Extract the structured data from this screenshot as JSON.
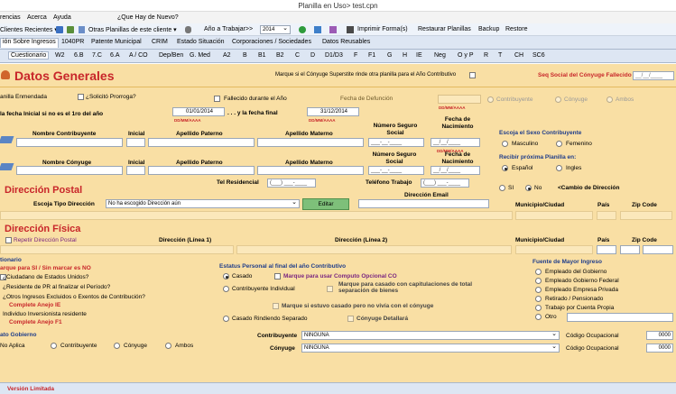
{
  "window": {
    "title": "Planilla en Uso> test.cpn"
  },
  "menu": {
    "items": [
      "rencias",
      "Acerca",
      "Ayuda",
      "¿Que Hay de Nuevo?"
    ]
  },
  "toolbar": {
    "clients": "Clientes Recientes ▾",
    "other": "Otras Planillas de este cliente ▾",
    "year_label": "Año a Trabajar>>",
    "year": "2014",
    "print": "Imprimir Forma(s)",
    "restore": "Restaurar Planillas",
    "backup": "Backup",
    "restaurar": "Restore"
  },
  "tabs1": [
    "ión Sobre Ingresos",
    "1040PR",
    "Patente Municipal",
    "CRIM",
    "Estado Situación",
    "Corporaciones / Sociedades",
    "Datos Reusables"
  ],
  "tabs2": [
    "Cuestionario",
    "W2",
    "6.B",
    "7.C",
    "6.A",
    "A / CO",
    "Dep/Ben",
    "G. Med",
    "A2",
    "B",
    "B1",
    "B2",
    "C",
    "D",
    "D1/D3",
    "F",
    "F1",
    "G",
    "H",
    "IE",
    "Neg",
    "O y P",
    "R",
    "T",
    "CH",
    "SC6"
  ],
  "form": {
    "title": "Datos Generales",
    "superstite": "Marque si el Cónyuge Superstite rinde otra planilla para el Año Contributivo",
    "ss_fallecido": "Seq Social del Cónyuge Fallecido",
    "ss_fallecido_val": "__/__/____",
    "enmendada": "anilla Enmendada",
    "prorroga": "¿Solicitó Prorroga?",
    "fallecido": "Fallecido durante el Año",
    "fecha_def": "Fecha de Defunción",
    "contribuyente_opt": "Contribuyente",
    "conyuge_opt": "Cónyuge",
    "ambos_opt": "Ambos",
    "fecha_inicial": "la fecha Inicial si no es el 1ro del año",
    "fecha_ini_val": "01/01/2014",
    "y_fecha_final": ". . . y la fecha final",
    "fecha_fin_val": "31/12/2014",
    "fmt": "DD/MM/AAAA",
    "nombre_contrib": "Nombre Contribuyente",
    "inicial": "Inicial",
    "ap_paterno": "Apellido Paterno",
    "ap_materno": "Apellido Materno",
    "num_ss": "Número Seguro Social",
    "fecha_nac": "Fecha de Nacimiento",
    "ss_mask": "___-__-____",
    "date_mask": "__/__/____",
    "sexo": "Escoja el Sexo Contribuyente",
    "masculino": "Masculino",
    "femenino": "Femenino",
    "nombre_cony": "Nombre Cónyuge",
    "recibir": "Recibir próxima Planilla en:",
    "espanol": "Español",
    "ingles": "Ingles",
    "tel_res": "Tel Residencial",
    "tel_mask": "(___) ___-____",
    "tel_trab": "Teléfono Trabajo",
    "si": "SI",
    "no": "No",
    "cambio_dir": "<Cambio de Dirección",
    "dir_postal": "Dirección Postal",
    "escoja_tipo": "Escoja Tipo Dirección",
    "dir_email": "Dirección Email",
    "tipo_val": "No ha escogido Dirección aún",
    "editar": "Editar",
    "municipio": "Municipio/Ciudad",
    "pais": "País",
    "zip": "Zip Code",
    "dir_fisica": "Dirección Física",
    "repetir": "Repetir Dirección Postal",
    "linea1": "Dirección (Línea 1)",
    "linea2": "Dirección (Línea 2)",
    "cuestionario": "tionario",
    "marque_si": "arque para SI / Sin marcar es NO",
    "q1": "¿Ciudadano de Estados Unidos?",
    "q2": "¿Residente de PR al finalizar el Período?",
    "q3": "¿Otros Ingresos Excluidos o Exentos de Contribución?",
    "anejo_ie": "Complete Anejo IE",
    "q4": "Individuo Inversionista residente",
    "anejo_f1": "Complete Anejo F1",
    "estatus": "Estatus Personal al final del año Contributivo",
    "casado": "Casado",
    "computo": "Marque para usar Computo Opcional CO",
    "individual": "Contribuyente Individual",
    "capitulaciones": "Marque para casado con capitulaciones de total separación de bienes",
    "no_vivia": "Marque si estuvo casado pero no vivía con el cónyuge",
    "separado": "Casado Rindiendo Separado",
    "detallara": "Cónyuge Detallará",
    "fuente": "Fuente de Mayor Ingreso",
    "f1": "Empleado del Gobierno",
    "f2": "Empleado Gobierno Federal",
    "f3": "Empleado Empresa Privada",
    "f4": "Retirado / Pensionado",
    "f5": "Trabajo por Cuenta Propia",
    "f6": "Otro",
    "empleado_gob": "ato Gobierno",
    "no_aplica": "No Aplica",
    "contrib2": "Contribuyente",
    "cony2": "Cónyuge",
    "ambos2": "Ambos",
    "ninguna": "NINGUNA",
    "cod_ocup": "Código Ocupacional",
    "cod_val": "0000"
  },
  "status": {
    "version": "Versión Limitada"
  }
}
